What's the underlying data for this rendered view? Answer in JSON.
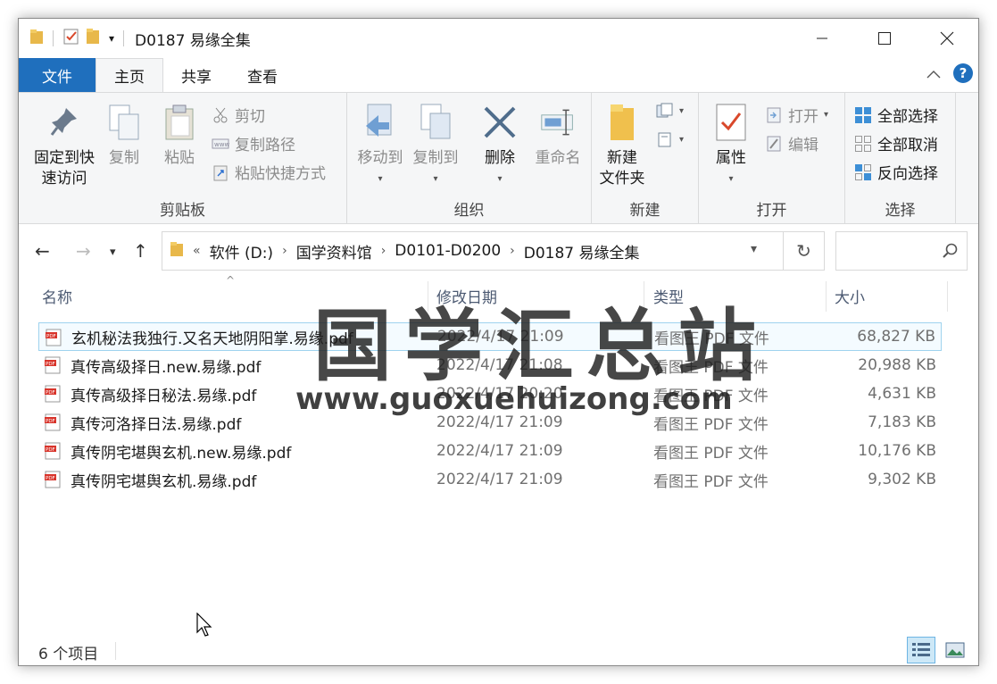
{
  "window": {
    "title": "D0187 易缘全集"
  },
  "tabs": {
    "file": "文件",
    "home": "主页",
    "share": "共享",
    "view": "查看"
  },
  "ribbon": {
    "clipboard": {
      "label": "剪贴板",
      "pin_line1": "固定到快",
      "pin_line2": "速访问",
      "copy": "复制",
      "paste": "粘贴",
      "cut": "剪切",
      "copy_path": "复制路径",
      "paste_shortcut": "粘贴快捷方式"
    },
    "organize": {
      "label": "组织",
      "move_to": "移动到",
      "copy_to": "复制到",
      "delete": "删除",
      "rename": "重命名"
    },
    "new": {
      "label": "新建",
      "new_folder_line1": "新建",
      "new_folder_line2": "文件夹"
    },
    "open": {
      "label": "打开",
      "properties": "属性",
      "open": "打开",
      "edit": "编辑"
    },
    "select": {
      "label": "选择",
      "select_all": "全部选择",
      "select_none": "全部取消",
      "invert": "反向选择"
    }
  },
  "address": {
    "overflow": "«",
    "crumbs": [
      "软件 (D:)",
      "国学资料馆",
      "D0101-D0200",
      "D0187 易缘全集"
    ]
  },
  "columns": {
    "name": "名称",
    "date": "修改日期",
    "type": "类型",
    "size": "大小"
  },
  "files": [
    {
      "name": "玄机秘法我独行.又名天地阴阳掌.易缘.pdf",
      "date": "2022/4/17 21:09",
      "type": "看图王 PDF 文件",
      "size": "68,827 KB"
    },
    {
      "name": "真传高级择日.new.易缘.pdf",
      "date": "2022/4/17 21:08",
      "type": "看图王 PDF 文件",
      "size": "20,988 KB"
    },
    {
      "name": "真传高级择日秘法.易缘.pdf",
      "date": "2022/4/17 20:20",
      "type": "看图王 PDF 文件",
      "size": "4,631 KB"
    },
    {
      "name": "真传河洛择日法.易缘.pdf",
      "date": "2022/4/17 21:09",
      "type": "看图王 PDF 文件",
      "size": "7,183 KB"
    },
    {
      "name": "真传阴宅堪舆玄机.new.易缘.pdf",
      "date": "2022/4/17 21:09",
      "type": "看图王 PDF 文件",
      "size": "10,176 KB"
    },
    {
      "name": "真传阴宅堪舆玄机.易缘.pdf",
      "date": "2022/4/17 21:09",
      "type": "看图王 PDF 文件",
      "size": "9,302 KB"
    }
  ],
  "status": {
    "count": "6 个项目"
  },
  "watermark": {
    "title": "国学汇总站",
    "url": "www.guoxuehuizong.com"
  },
  "colors": {
    "file_tab": "#1f6fbd",
    "ribbon_bg": "#f5f6f7",
    "selection": "#9fd3ee"
  }
}
